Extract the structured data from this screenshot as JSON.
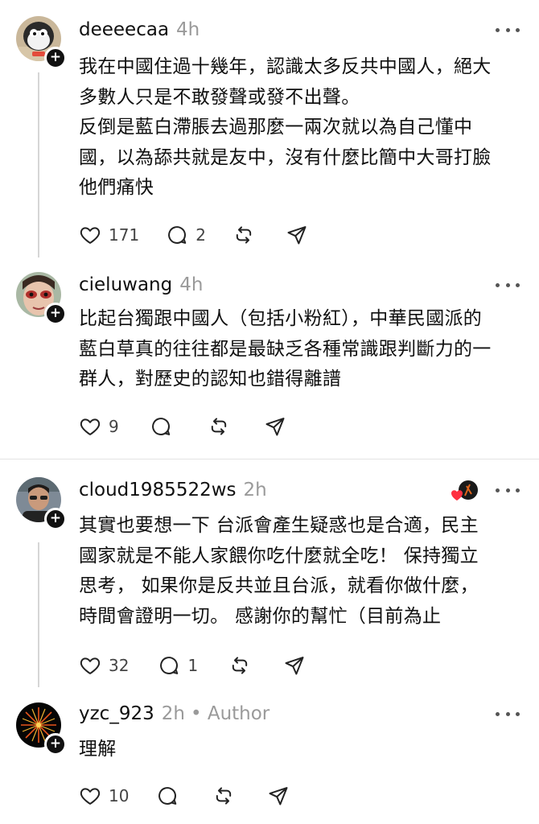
{
  "posts": [
    {
      "username": "deeeecaa",
      "time": "4h",
      "text": "我在中國住過十幾年，認識太多反共中國人，絕大\n多數人只是不敢發聲或發不出聲。\n反倒是藍白滯脹去過那麼一兩次就以為自己懂中\n國，以為舔共就是友中，沒有什麼比簡中大哥打臉\n他們痛快",
      "likes": "171",
      "replies": "2",
      "avatar_icon": "cartoon-avatar"
    },
    {
      "username": "cieluwang",
      "time": "4h",
      "text": "比起台獨跟中國人（包括小粉紅），中華民國派的\n藍白草真的往往都是最缺乏各種常識跟判斷力的一\n群人，對歷史的認知也錯得離譜",
      "likes": "9",
      "avatar_icon": "face-avatar"
    },
    {
      "username": "cloud1985522ws",
      "time": "2h",
      "text": "其實也要想一下 台派會產生疑惑也是合適，民主\n國家就是不能人家餵你吃什麼就全吃！ 保持獨立\n思考， 如果你是反共並且台派，就看你做什麼，\n時間會證明一切。 感謝你的幫忙（目前為止",
      "likes": "32",
      "replies": "1",
      "avatar_icon": "man-avatar",
      "badge_icon": "liked-by-author-heart-icon"
    },
    {
      "username": "yzc_923",
      "time": "2h",
      "author_tag": "• Author",
      "text": "理解",
      "likes": "10",
      "avatar_icon": "fireworks-avatar"
    }
  ],
  "colors": {
    "text": "#101010",
    "muted": "#9a9a9a",
    "divider": "#e3e3e3",
    "heart": "#ff3040"
  }
}
